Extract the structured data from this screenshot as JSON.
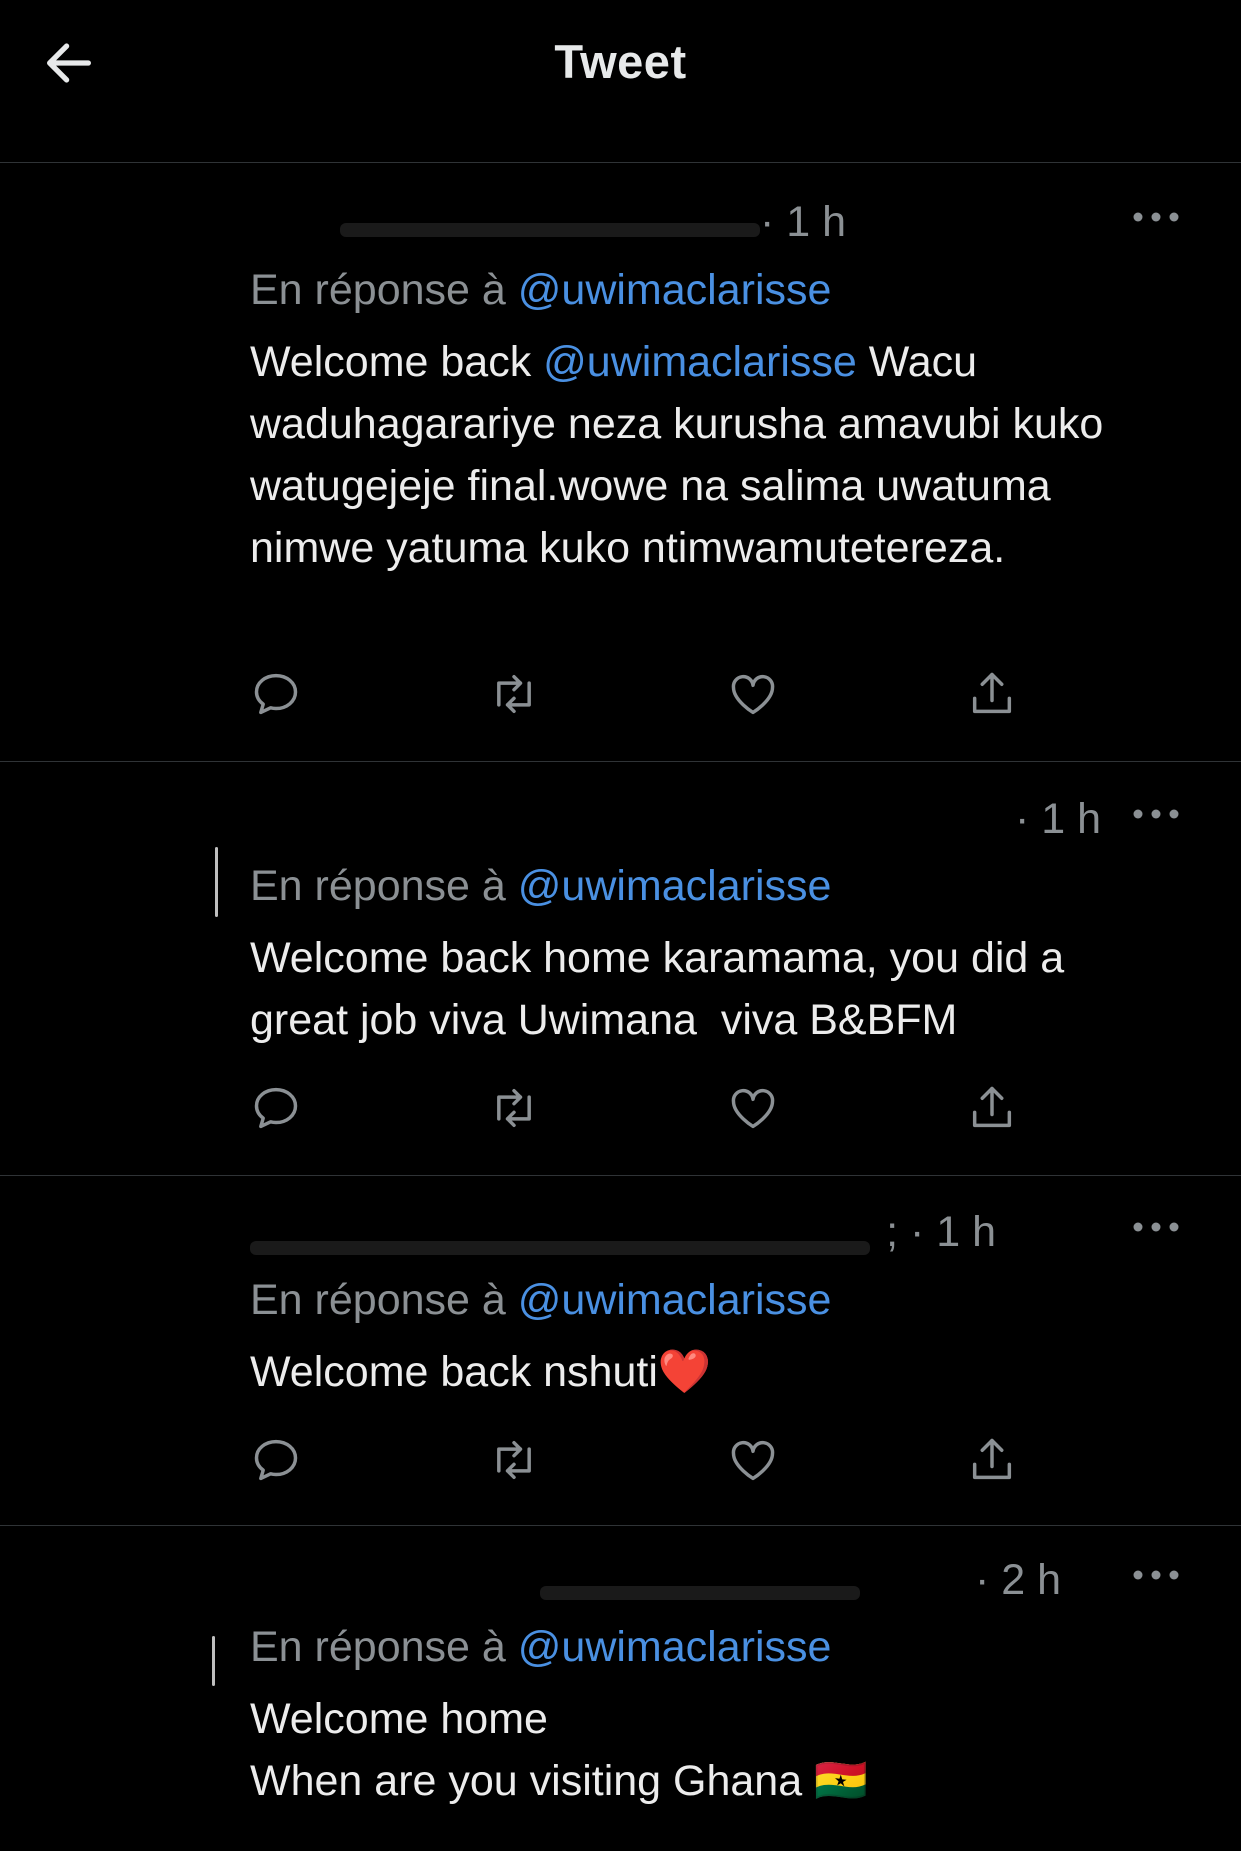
{
  "header": {
    "title": "Tweet"
  },
  "tweets": [
    {
      "time": "· 1 h",
      "reply_prefix": "En réponse à",
      "reply_handle": "@uwimaclarisse",
      "text_before": "Welcome back ",
      "text_mention": "@uwimaclarisse",
      "text_after": " Wacu waduhagarariye neza kurusha amavubi kuko watugejeje final.wowe na salima uwatuma nimwe yatuma kuko ntimwamutetereza."
    },
    {
      "time": "· 1 h",
      "reply_prefix": "En réponse à",
      "reply_handle": "@uwimaclarisse",
      "text": "Welcome back home karamama, you did a great job viva Uwimana  viva B&BFM"
    },
    {
      "time": "; · 1 h",
      "reply_prefix": "En réponse à",
      "reply_handle": "@uwimaclarisse",
      "text": "Welcome back nshuti❤️"
    },
    {
      "time": "· 2 h",
      "reply_prefix": "En réponse à",
      "reply_handle": "@uwimaclarisse",
      "text": "Welcome home\nWhen are you visiting Ghana 🇬🇭"
    }
  ],
  "icons": {
    "back": "arrow-left-icon",
    "more": "more-horizontal-icon",
    "reply": "reply-icon",
    "retweet": "retweet-icon",
    "like": "heart-icon",
    "share": "share-icon"
  },
  "colors": {
    "background": "#000000",
    "text": "#e7e9ea",
    "secondary": "#8b9094",
    "link": "#4a90e2",
    "divider": "#2f3336"
  }
}
